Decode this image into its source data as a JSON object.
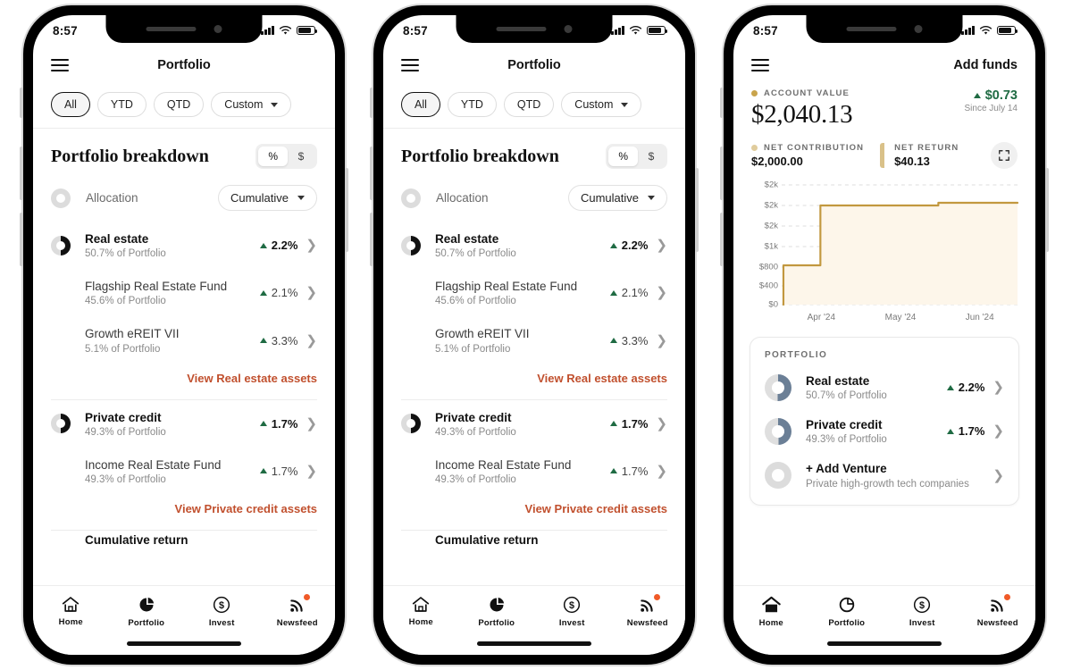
{
  "status": {
    "time": "8:57"
  },
  "phone1": {
    "header": {
      "menu_icon": "hamburger-icon",
      "title": "Portfolio"
    },
    "filters": [
      {
        "label": "All",
        "active": true
      },
      {
        "label": "YTD",
        "active": false
      },
      {
        "label": "QTD",
        "active": false
      },
      {
        "label": "Custom",
        "active": false,
        "dropdown": true
      }
    ],
    "breakdown": {
      "title": "Portfolio breakdown",
      "unit_toggle": {
        "percent": "%",
        "dollar": "$",
        "selected": "%"
      },
      "allocation_label": "Allocation",
      "mode_select": "Cumulative"
    },
    "groups": [
      {
        "name": "Real estate",
        "subtitle": "50.7% of Portfolio",
        "change": "2.2%",
        "direction": "up",
        "items": [
          {
            "name": "Flagship Real Estate Fund",
            "subtitle": "45.6% of Portfolio",
            "change": "2.1%",
            "direction": "up"
          },
          {
            "name": "Growth eREIT VII",
            "subtitle": "5.1% of Portfolio",
            "change": "3.3%",
            "direction": "up"
          }
        ],
        "view_link": "View Real estate assets"
      },
      {
        "name": "Private credit",
        "subtitle": "49.3% of Portfolio",
        "change": "1.7%",
        "direction": "up",
        "items": [
          {
            "name": "Income Real Estate Fund",
            "subtitle": "49.3% of Portfolio",
            "change": "1.7%",
            "direction": "up"
          }
        ],
        "view_link": "View Private credit assets"
      }
    ],
    "clipped_row": "Cumulative return"
  },
  "phone3": {
    "header": {
      "menu_icon": "hamburger-icon",
      "action": "Add funds"
    },
    "account": {
      "kicker": "ACCOUNT VALUE",
      "value": "$2,040.13",
      "delta": "$0.73",
      "delta_direction": "up",
      "since": "Since July 14"
    },
    "metrics": [
      {
        "kicker": "NET CONTRIBUTION",
        "value": "$2,000.00"
      },
      {
        "kicker": "NET RETURN",
        "value": "$40.13"
      }
    ],
    "expand_icon": "expand-icon",
    "card": {
      "title": "PORTFOLIO",
      "rows": [
        {
          "name": "Real estate",
          "subtitle": "50.7% of Portfolio",
          "change": "2.2%",
          "direction": "up"
        },
        {
          "name": "Private credit",
          "subtitle": "49.3% of Portfolio",
          "change": "1.7%",
          "direction": "up"
        },
        {
          "name": "+ Add Venture",
          "subtitle": "Private high-growth tech companies",
          "change": "",
          "direction": "none"
        }
      ]
    }
  },
  "tabbar": [
    {
      "label": "Home",
      "icon": "home-icon",
      "badge": false
    },
    {
      "label": "Portfolio",
      "icon": "pie-chart-icon",
      "badge": false
    },
    {
      "label": "Invest",
      "icon": "dollar-circle-icon",
      "badge": false
    },
    {
      "label": "Newsfeed",
      "icon": "rss-icon",
      "badge": true
    }
  ],
  "colors": {
    "accent_link": "#c1502e",
    "positive": "#1f6b43",
    "chart_line": "#c2983f",
    "chart_fill": "#fdf7ec",
    "donut_blue": "#6b7f96",
    "badge": "#f05a28"
  },
  "chart_data": {
    "type": "area",
    "title": "",
    "xlabel": "",
    "ylabel": "",
    "x_tick_labels": [
      "Apr '24",
      "May '24",
      "Jun '24"
    ],
    "y_tick_labels": [
      "$2k",
      "$2k",
      "$2k",
      "$1k",
      "$800",
      "$400",
      "$0"
    ],
    "y_tick_values": [
      2400,
      2000,
      1600,
      1200,
      800,
      400,
      0
    ],
    "ylim": [
      0,
      2400
    ],
    "grid": true,
    "legend": "none",
    "series": [
      {
        "name": "Account value",
        "x": [
          "Apr 01 '24",
          "Apr 03 '24",
          "Apr 20 '24",
          "Apr 22 '24",
          "Jun 10 '24",
          "Jun 12 '24",
          "Jun 30 '24"
        ],
        "values": [
          0,
          900,
          900,
          2000,
          2000,
          2040,
          2040
        ]
      }
    ]
  }
}
